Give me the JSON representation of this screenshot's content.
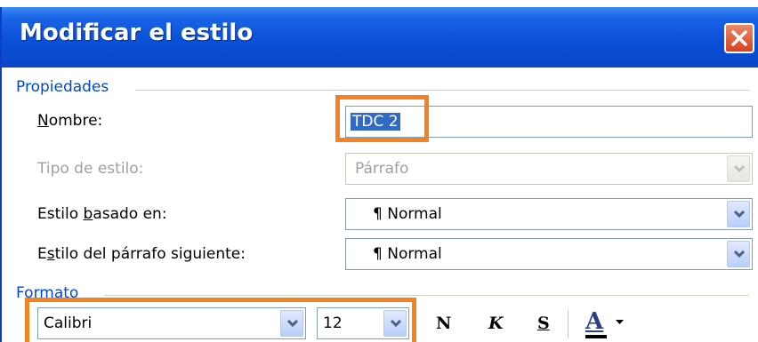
{
  "dialog": {
    "title": "Modificar el estilo",
    "close_label": "×"
  },
  "propiedades": {
    "group_title": "Propiedades",
    "nombre": {
      "label_accel": "N",
      "label_rest": "ombre:",
      "value": "TDC 2"
    },
    "tipo": {
      "label": "Tipo de estilo:",
      "value": "Párrafo"
    },
    "basado": {
      "label_pre": "Estilo ",
      "label_accel": "b",
      "label_rest": "asado en:",
      "value": "Normal",
      "mark": "¶"
    },
    "siguiente": {
      "label_pre": "E",
      "label_accel": "s",
      "label_rest": "tilo del párrafo siguiente:",
      "value": "Normal",
      "mark": "¶"
    }
  },
  "formato": {
    "group_title": "Formato",
    "font": "Calibri",
    "size": "12",
    "bold": "N",
    "italic": "K",
    "underline": "S",
    "font_color": "A"
  },
  "colors": {
    "highlight": "#f58220",
    "group_title": "#0046d5"
  }
}
